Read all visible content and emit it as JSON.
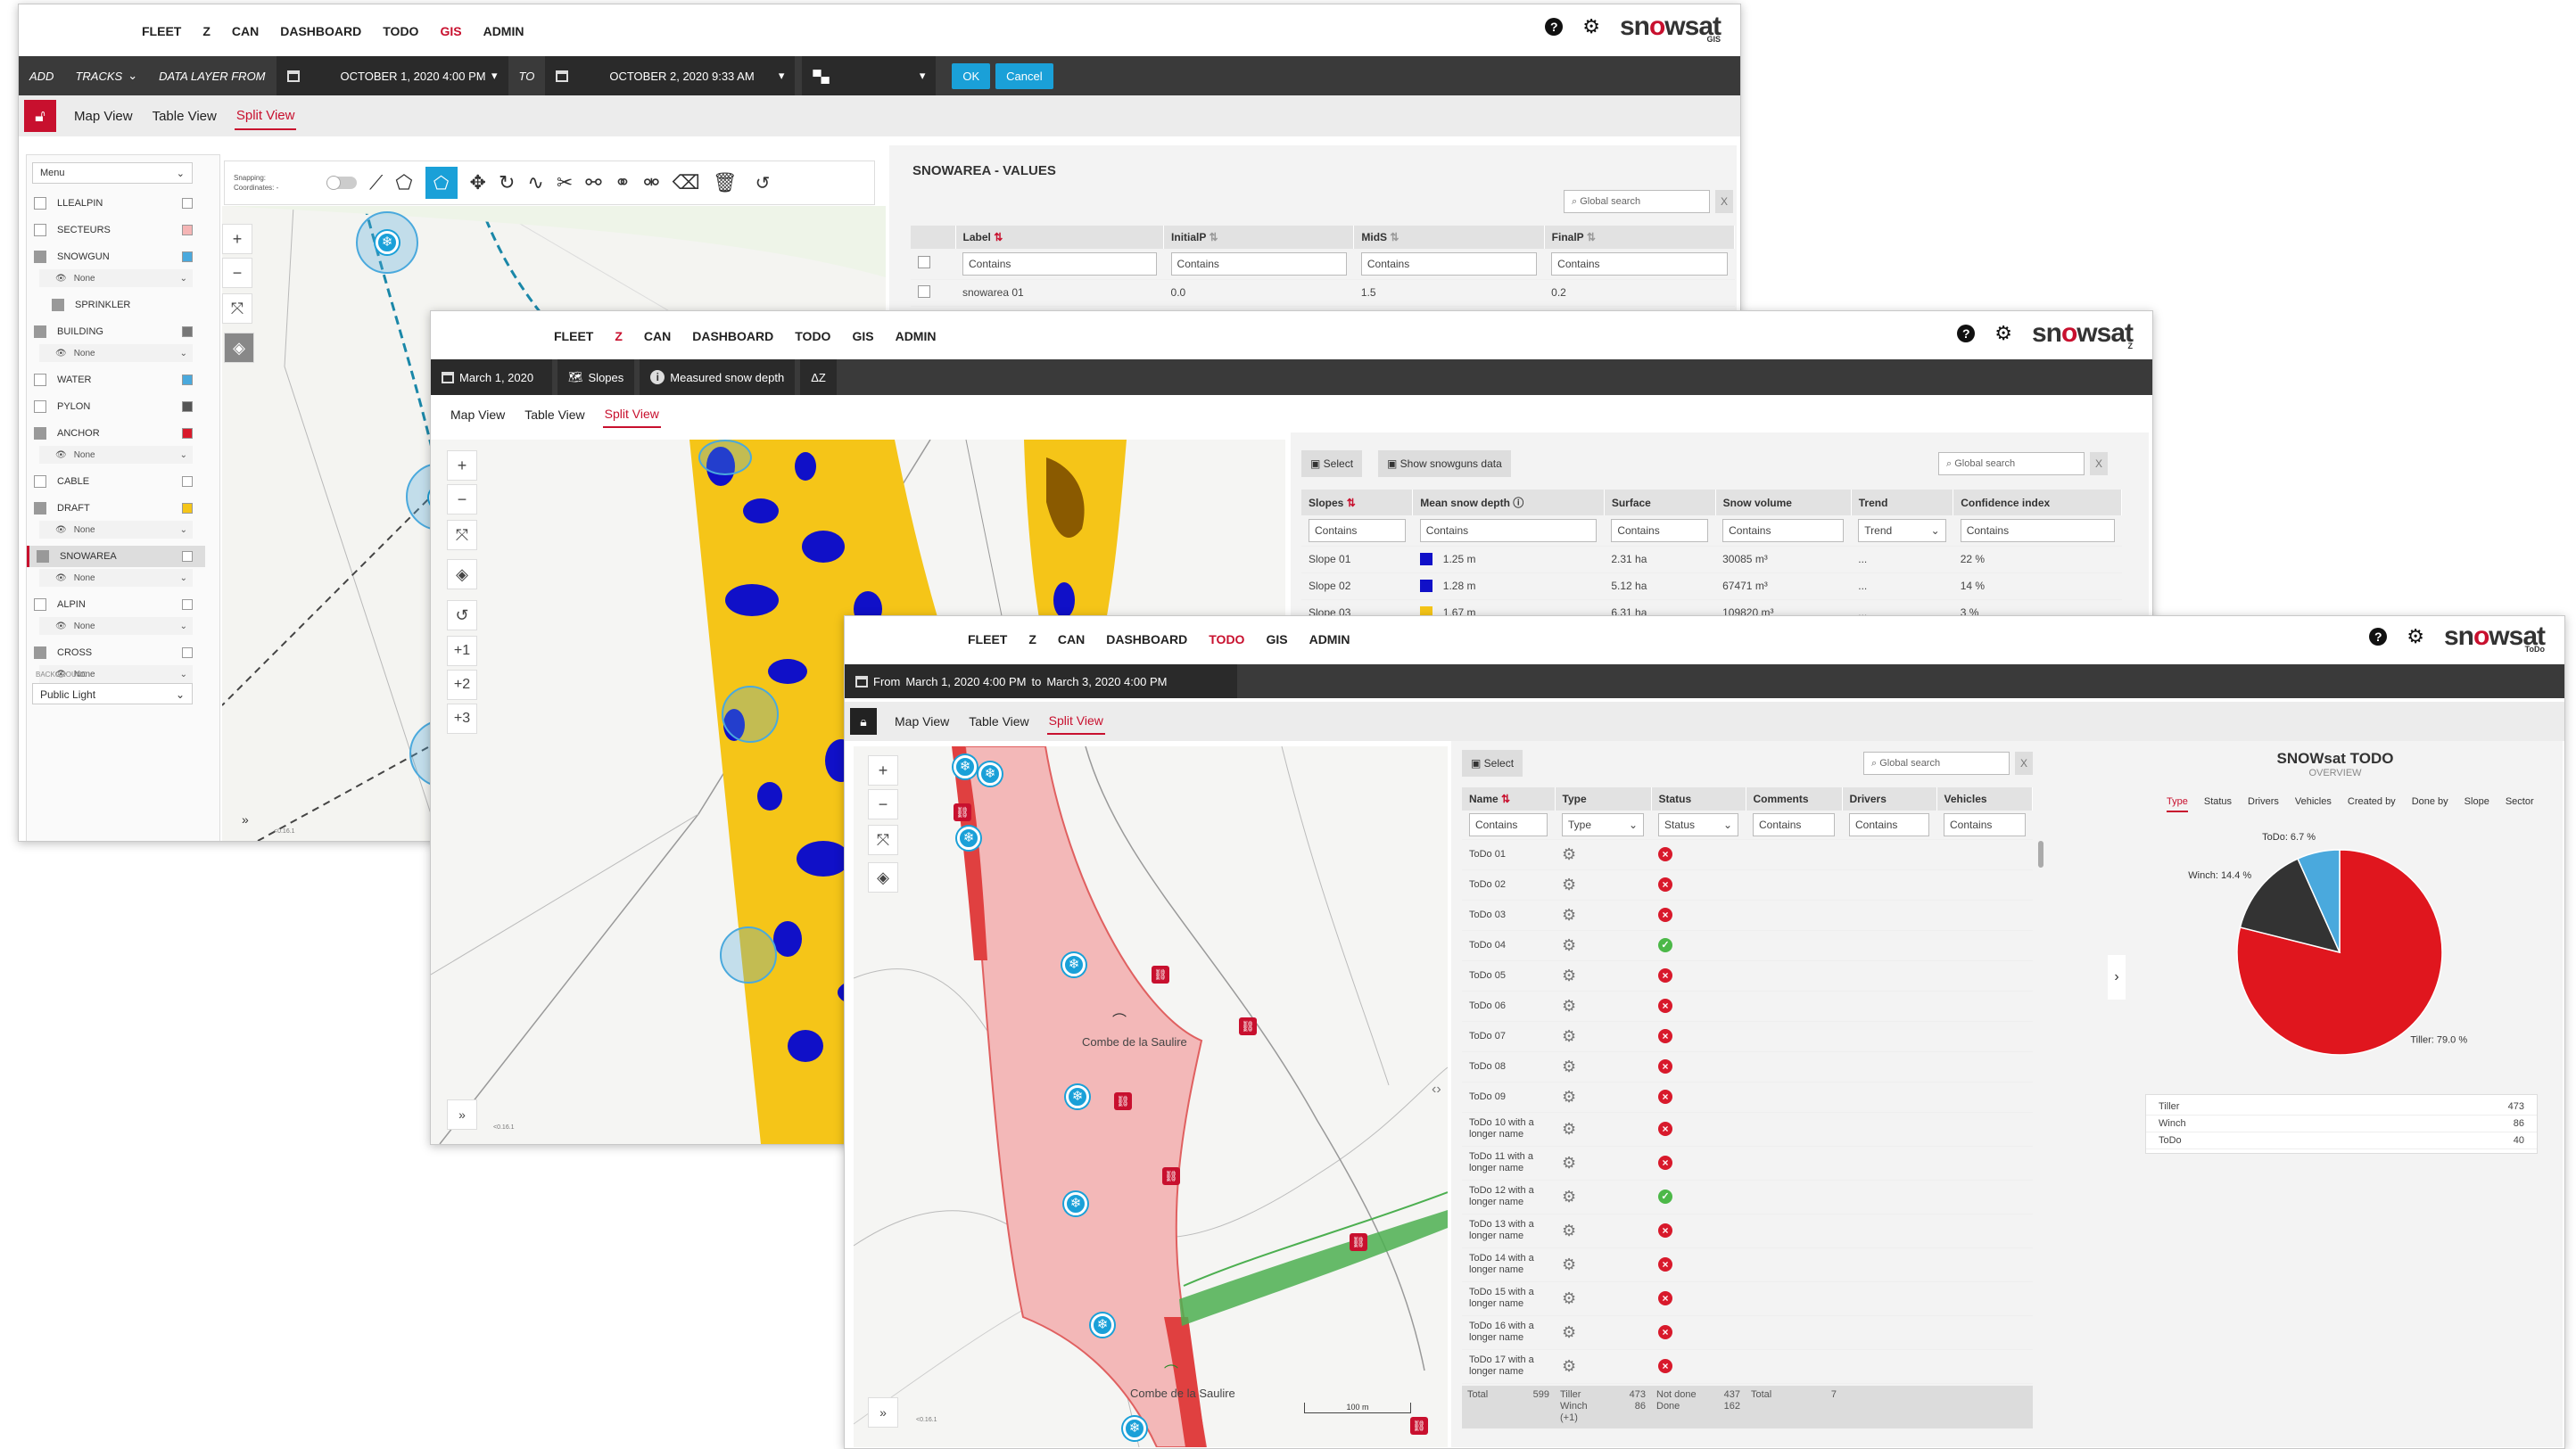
{
  "brand": {
    "logo_a": "sn",
    "logo_o": "o",
    "logo_b": "wsat"
  },
  "w1": {
    "nav": [
      "FLEET",
      "Z",
      "CAN",
      "DASHBOARD",
      "TODO",
      "GIS",
      "ADMIN"
    ],
    "nav_active": 5,
    "logo_sub": "GIS",
    "bar": {
      "add": "ADD",
      "tracks": "TRACKS",
      "data_layer_from": "DATA LAYER FROM",
      "from_date": "OCTOBER 1, 2020 4:00 PM",
      "to": "TO",
      "to_date": "OCTOBER 2, 2020 9:33 AM",
      "ok": "OK",
      "cancel": "Cancel"
    },
    "tabs": [
      "Map View",
      "Table View",
      "Split View"
    ],
    "menu_label": "Menu",
    "snapping": "Snapping:",
    "coordinates": "Coordinates: -",
    "layers": [
      {
        "name": "LLEALPIN",
        "checked": false,
        "swatch": "#ffffff"
      },
      {
        "name": "SECTEURS",
        "checked": false,
        "swatch": "#f5b5b5"
      },
      {
        "name": "SNOWGUN",
        "checked": true,
        "swatch": "#4aa9dd",
        "sub": "None"
      },
      {
        "name": "SPRINKLER",
        "checked": true,
        "swatch": "",
        "indent": true
      },
      {
        "name": "BUILDING",
        "checked": true,
        "swatch": "#777777",
        "sub": "None"
      },
      {
        "name": "WATER",
        "checked": false,
        "swatch": "#4aa9dd"
      },
      {
        "name": "PYLON",
        "checked": false,
        "swatch": "#555555"
      },
      {
        "name": "ANCHOR",
        "checked": true,
        "swatch": "#d8192b",
        "sub": "None"
      },
      {
        "name": "CABLE",
        "checked": false,
        "swatch": "#ffffff"
      },
      {
        "name": "DRAFT",
        "checked": true,
        "swatch": "#f5c518",
        "sub": "None"
      },
      {
        "name": "SNOWAREA",
        "checked": true,
        "swatch": "#ffffff",
        "sub": "None",
        "selected": true
      },
      {
        "name": "ALPIN",
        "checked": false,
        "swatch": "#ffffff",
        "sub": "None"
      },
      {
        "name": "CROSS",
        "checked": true,
        "swatch": "#ffffff",
        "sub": "None"
      }
    ],
    "background_label": "BACKGROUND",
    "background_value": "Public Light",
    "scale": "<0.16.1",
    "table_title": "SNOWAREA - VALUES",
    "global_search": "Global search",
    "columns": [
      "Label",
      "InitialP",
      "MidS",
      "FinalP"
    ],
    "filter": "Contains",
    "rows": [
      [
        "snowarea 01",
        "0.0",
        "1.5",
        "0.2"
      ]
    ]
  },
  "w2": {
    "nav": [
      "FLEET",
      "Z",
      "CAN",
      "DASHBOARD",
      "TODO",
      "GIS",
      "ADMIN"
    ],
    "nav_active": 1,
    "logo_sub": "Z",
    "bar": {
      "date": "March 1, 2020",
      "slopes": "Slopes",
      "measured": "Measured snow depth",
      "dz": "ΔZ"
    },
    "tabs": [
      "Map View",
      "Table View",
      "Split View"
    ],
    "zoom_btns": [
      "+1",
      "+2",
      "+3"
    ],
    "select": "Select",
    "show_snowguns": "Show snowguns data",
    "global_search": "Global search",
    "columns": [
      "Slopes",
      "Mean snow depth",
      "Surface",
      "Snow volume",
      "Trend",
      "Confidence index"
    ],
    "filters": [
      "Contains",
      "Contains",
      "Contains",
      "Contains",
      "Trend",
      "Contains"
    ],
    "rows": [
      {
        "slope": "Slope 01",
        "color": "#1010c8",
        "depth": "1.25 m",
        "surface": "2.31 ha",
        "volume": "30085 m³",
        "trend": "...",
        "conf": "22 %"
      },
      {
        "slope": "Slope 02",
        "color": "#1010c8",
        "depth": "1.28 m",
        "surface": "5.12 ha",
        "volume": "67471 m³",
        "trend": "...",
        "conf": "14 %"
      },
      {
        "slope": "Slope 03",
        "color": "#f5c518",
        "depth": "1.67 m",
        "surface": "6.31 ha",
        "volume": "109820 m³",
        "trend": "...",
        "conf": "3 %"
      }
    ],
    "scale": "<0.16.1"
  },
  "w3": {
    "nav": [
      "FLEET",
      "Z",
      "CAN",
      "DASHBOARD",
      "TODO",
      "GIS",
      "ADMIN"
    ],
    "nav_active": 4,
    "logo_sub": "ToDo",
    "bar": {
      "from": "From",
      "from_date": "March 1, 2020 4:00 PM",
      "to": "to",
      "to_date": "March 3, 2020 4:00 PM"
    },
    "tabs": [
      "Map View",
      "Table View",
      "Split View"
    ],
    "select": "Select",
    "global_search": "Global search",
    "columns": [
      "Name",
      "Type",
      "Status",
      "Comments",
      "Drivers",
      "Vehicles"
    ],
    "filters": [
      "Contains",
      "Type",
      "Status",
      "Contains",
      "Contains",
      "Contains"
    ],
    "rows": [
      {
        "name": "ToDo 01",
        "ok": false
      },
      {
        "name": "ToDo 02",
        "ok": false
      },
      {
        "name": "ToDo 03",
        "ok": false
      },
      {
        "name": "ToDo 04",
        "ok": true
      },
      {
        "name": "ToDo 05",
        "ok": false
      },
      {
        "name": "ToDo 06",
        "ok": false
      },
      {
        "name": "ToDo 07",
        "ok": false
      },
      {
        "name": "ToDo 08",
        "ok": false
      },
      {
        "name": "ToDo 09",
        "ok": false
      },
      {
        "name": "ToDo 10 with a longer name",
        "ok": false
      },
      {
        "name": "ToDo 11 with a longer name",
        "ok": false
      },
      {
        "name": "ToDo 12 with a longer name",
        "ok": true
      },
      {
        "name": "ToDo 13 with a longer name",
        "ok": false
      },
      {
        "name": "ToDo 14 with a longer name",
        "ok": false
      },
      {
        "name": "ToDo 15 with a longer name",
        "ok": false
      },
      {
        "name": "ToDo 16 with a longer name",
        "ok": false
      },
      {
        "name": "ToDo 17 with a longer name",
        "ok": false
      }
    ],
    "footer": {
      "total_label": "Total",
      "total": "599",
      "tiller": "Tiller",
      "tiller_n": "473",
      "winch": "Winch",
      "winch_n": "86",
      "plus": "(+1)",
      "notdone": "Not done",
      "notdone_n": "437",
      "done": "Done",
      "done_n": "162",
      "c_total": "Total",
      "c_total_n": "7"
    },
    "map_labels": [
      "Combe de la Saulire",
      "Combe de la Saulire"
    ],
    "scalebar": "100 m",
    "scale": "<0.16.1",
    "overview_title": "SNOWsat TODO",
    "overview_sub": "OVERVIEW",
    "ov_tabs": [
      "Type",
      "Status",
      "Drivers",
      "Vehicles",
      "Created by",
      "Done by",
      "Slope",
      "Sector"
    ],
    "legend": [
      {
        "name": "Tiller",
        "value": "473"
      },
      {
        "name": "Winch",
        "value": "86"
      },
      {
        "name": "ToDo",
        "value": "40"
      }
    ]
  },
  "chart_data": {
    "type": "pie",
    "categories": [
      "Tiller",
      "Winch",
      "ToDo"
    ],
    "values": [
      79.0,
      14.4,
      6.7
    ],
    "labels": [
      "Tiller: 79.0 %",
      "Winch: 14.4 %",
      "ToDo: 6.7 %"
    ],
    "colors": [
      "#e0161e",
      "#333333",
      "#4aa9dd"
    ]
  }
}
